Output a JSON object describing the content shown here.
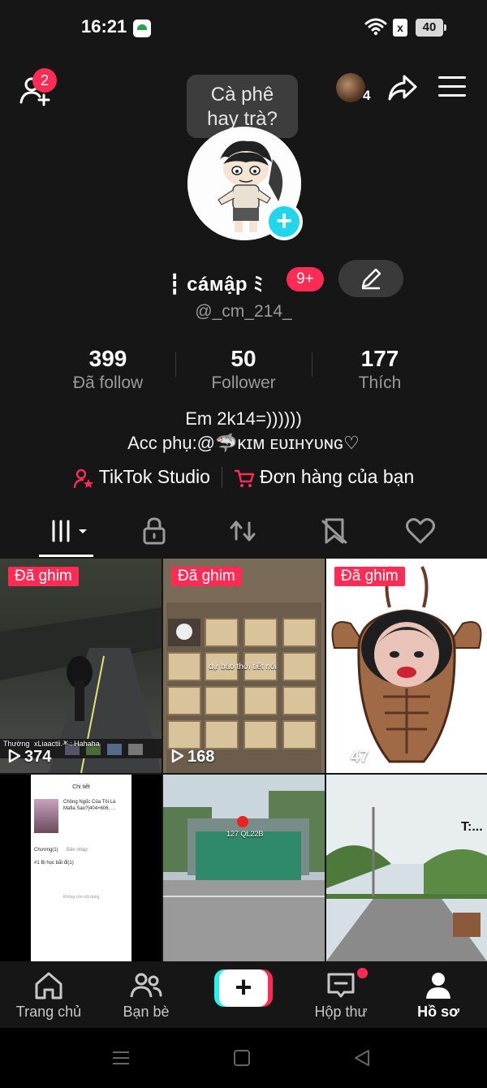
{
  "status_bar": {
    "time": "16:21",
    "sim_label": "x",
    "battery": "40"
  },
  "top_bar": {
    "friend_requests_badge": "2",
    "visitors_count": "4"
  },
  "tooltip": {
    "line1": "Cà phê",
    "line2": "hay trà?"
  },
  "profile": {
    "display_name": "┇ cáмập ﾐ",
    "name_badge": "9+",
    "username": "@_cm_214_",
    "stats": [
      {
        "value": "399",
        "label": "Đã follow"
      },
      {
        "value": "50",
        "label": "Follower"
      },
      {
        "value": "177",
        "label": "Thích"
      }
    ],
    "bio_line1": "Em 2k14=))))))",
    "bio_line2": "Acc phụ:@🦈ᴋɪᴍ ᴇᴜɪʜʏᴜɴɢ♡"
  },
  "links": {
    "studio": "TikTok Studio",
    "orders": "Đơn hàng của bạn"
  },
  "videos": [
    {
      "pinned_label": "Đã ghim",
      "views": "374",
      "caption": "xLiaactii.ᴶᴷ : Hahaha",
      "rank": "Thường"
    },
    {
      "pinned_label": "Đã ghim",
      "views": "168",
      "caption": "dự báo thời tiết nói"
    },
    {
      "pinned_label": "Đã ghim",
      "views": "47"
    },
    {
      "title": "Chi tiết",
      "book_title": "Chồng Ngốc Của Tôi Là Mafia Sao?[404×606, ...",
      "chapter": "Chương(1)",
      "draft": "Bản nháp",
      "chapter_item": "#1  Bị học bắt đi(1)",
      "empty_note": "Không còn nội dung"
    },
    {
      "caption": "127 QL22B"
    },
    {
      "caption": "T:..."
    }
  ],
  "bottom_nav": [
    {
      "label": "Trang chủ"
    },
    {
      "label": "Bạn bè"
    },
    {
      "label": "Hộp thư"
    },
    {
      "label": "Hồ sơ"
    }
  ],
  "colors": {
    "background": "#161616",
    "accent_red": "#fe2c55",
    "accent_cyan": "#25f4ee",
    "muted_text": "#9a9a9a"
  }
}
